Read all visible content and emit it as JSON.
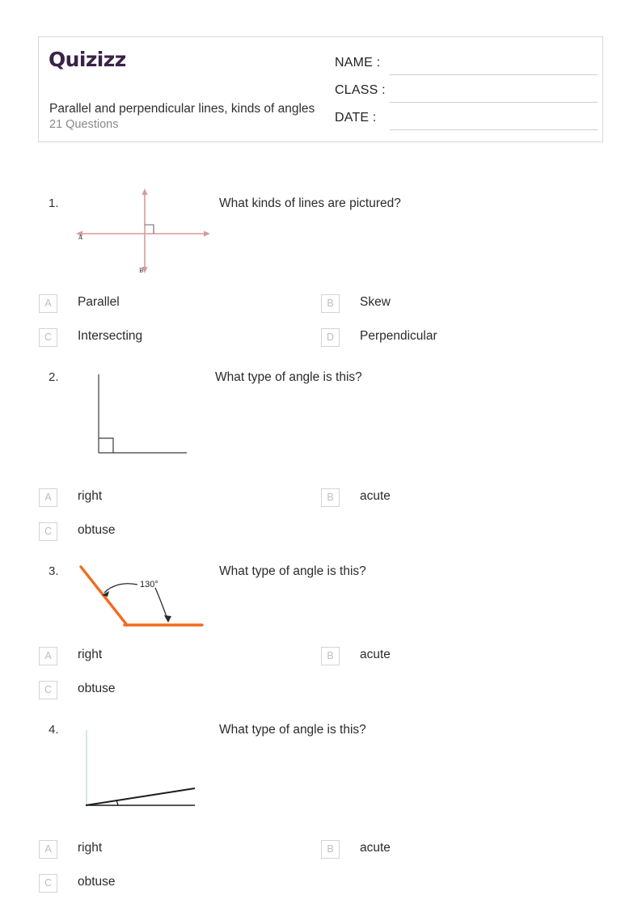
{
  "header": {
    "logo_text": "Quizizz",
    "title": "Parallel and perpendicular lines, kinds of angles",
    "subtitle": "21 Questions",
    "fields": [
      {
        "label": "NAME :"
      },
      {
        "label": "CLASS :"
      },
      {
        "label": "DATE  :"
      }
    ]
  },
  "questions": [
    {
      "number": "1.",
      "text": "What kinds of lines are pictured?",
      "figure": "perpendicular-lines-diagram",
      "figure_labels": {
        "horizontal_end": "A",
        "vertical_end": "B"
      },
      "options": [
        {
          "letter": "A",
          "label": "Parallel"
        },
        {
          "letter": "B",
          "label": "Skew"
        },
        {
          "letter": "C",
          "label": "Intersecting"
        },
        {
          "letter": "D",
          "label": "Perpendicular"
        }
      ]
    },
    {
      "number": "2.",
      "text": "What type of angle is this?",
      "figure": "right-angle-diagram",
      "options": [
        {
          "letter": "A",
          "label": "right"
        },
        {
          "letter": "B",
          "label": "acute"
        },
        {
          "letter": "C",
          "label": "obtuse"
        }
      ]
    },
    {
      "number": "3.",
      "text": "What type of angle is this?",
      "figure": "obtuse-angle-diagram",
      "figure_labels": {
        "angle_measure": "130°"
      },
      "options": [
        {
          "letter": "A",
          "label": "right"
        },
        {
          "letter": "B",
          "label": "acute"
        },
        {
          "letter": "C",
          "label": "obtuse"
        }
      ]
    },
    {
      "number": "4.",
      "text": "What type of angle is this?",
      "figure": "acute-angle-diagram",
      "options": [
        {
          "letter": "A",
          "label": "right"
        },
        {
          "letter": "B",
          "label": "acute"
        },
        {
          "letter": "C",
          "label": "obtuse"
        }
      ]
    }
  ],
  "colors": {
    "logo": "#3b2247",
    "line_rose": "#d89a9a",
    "angle_orange": "#f26b21",
    "figure_dark": "#3b3b3b",
    "figure_blue": "#b9d4da",
    "box_border": "#d4d4d4"
  }
}
